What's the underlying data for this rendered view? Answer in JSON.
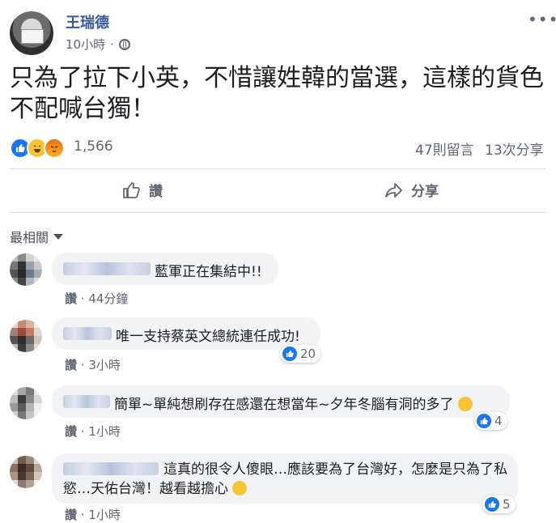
{
  "post": {
    "author": "王瑞德",
    "time": "10小時",
    "text": "只為了拉下小英，不惜讓姓韓的當選，這樣的貨色不配喊台獨！",
    "reaction_count": "1,566",
    "comments_count": "47則留言",
    "shares_count": "13次分享",
    "like_label": "讚",
    "share_label": "分享"
  },
  "sort_label": "最相關",
  "comments": [
    {
      "text": "藍軍正在集結中!!",
      "like_label": "讚",
      "time": "44分鐘",
      "reactions": ""
    },
    {
      "text": "唯一支持蔡英文總統連任成功!",
      "like_label": "讚",
      "time": "3小時",
      "reactions": "20"
    },
    {
      "text": "簡單~單純想刷存在感還在想當年~夕年冬腦有洞的多了",
      "like_label": "讚",
      "time": "1小時",
      "reactions": "4"
    },
    {
      "text": "這真的很令人傻眼…應該要為了台灣好，怎麼是只為了私慾…天佑台灣！越看越擔心",
      "like_label": "讚",
      "time": "1小時",
      "reactions": "5"
    }
  ],
  "colors": {
    "link": "#385898",
    "like_blue": "#1877f2",
    "meta": "#606770",
    "bubble": "#f2f3f5"
  },
  "icons": [
    "globe-icon",
    "more-icon",
    "like-icon",
    "share-icon",
    "caret-down-icon",
    "haha-icon",
    "angry-icon"
  ]
}
